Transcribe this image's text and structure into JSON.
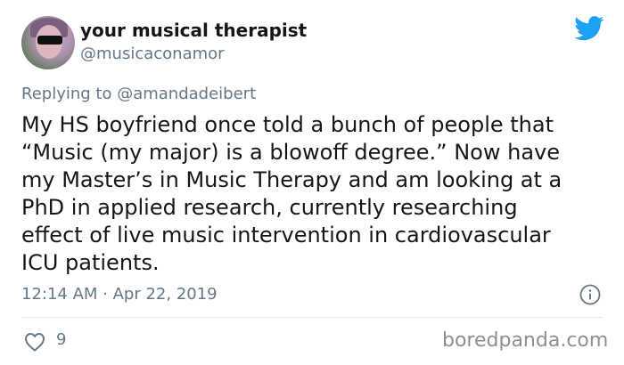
{
  "user": {
    "display_name": "your musical therapist",
    "handle": "@musicaconamor"
  },
  "reply": {
    "prefix": "Replying to ",
    "mention": "@amandadeibert"
  },
  "tweet": {
    "text": "My HS boyfriend once told a bunch of people that\n“Music (my major) is a blowoff degree.” Now have\nmy Master’s in Music Therapy and am looking at a\nPhD in applied research, currently researching\neffect of live music intervention in cardiovascular\nICU patients.",
    "timestamp": "12:14 AM · Apr 22, 2019"
  },
  "actions": {
    "like_count": "9"
  },
  "watermark": "boredpanda.com",
  "colors": {
    "twitter_blue": "#1da1f2",
    "secondary_text": "#657786"
  },
  "icons": [
    "twitter-bird-icon",
    "info-icon",
    "heart-icon"
  ]
}
